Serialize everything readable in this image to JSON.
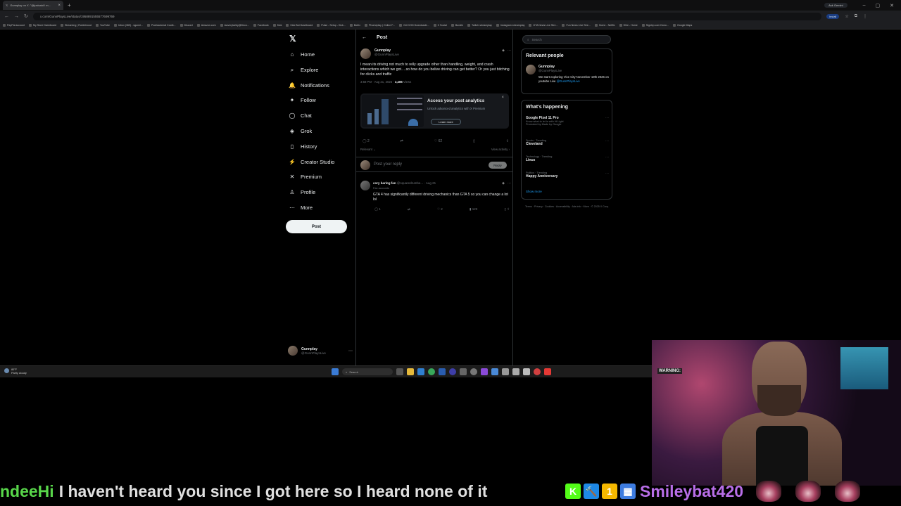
{
  "browser": {
    "tab_title": "Gunnplay on X: \"@justsaid I m…",
    "gemini_label": "Ask Gemini",
    "url": "x.com/GunnPlaysLive/status/1958891555577699769",
    "install_label": "Install",
    "bookmarks": [
      "PayPal account",
      "My Store Dashboard",
      "Streaming | Rubinbrood",
      "YouTube",
      "Inbox (369) - sgunnl...",
      "Pool/automat Coolb...",
      "Discord",
      "Amazon.com",
      "taoverylarkly@Deco...",
      "Facebook",
      "Kick",
      "Kick Bot Dashboard",
      "Pulse - Setup - Kick...",
      "Botrix",
      "Phomeplay | Online F...",
      "Grit VOD Downloade...",
      "X Social",
      "Bundle",
      "Twitch streamplay",
      "Instagram streamplay",
      "GTA News Live Stre...",
      "Fun News Live Stre...",
      "Home - Netflix",
      "Wire - Home",
      "SignUp.com Dono...",
      "Google Maps"
    ]
  },
  "nav": {
    "items": [
      {
        "label": "Home",
        "icon": "home-icon",
        "glyph": "⌂"
      },
      {
        "label": "Explore",
        "icon": "search-icon",
        "glyph": "⌕"
      },
      {
        "label": "Notifications",
        "icon": "bell-icon",
        "glyph": "🔔"
      },
      {
        "label": "Follow",
        "icon": "follow-icon",
        "glyph": "✦"
      },
      {
        "label": "Chat",
        "icon": "chat-icon",
        "glyph": "◯"
      },
      {
        "label": "Grok",
        "icon": "grok-icon",
        "glyph": "◈"
      },
      {
        "label": "History",
        "icon": "bookmark-icon",
        "glyph": "▯"
      },
      {
        "label": "Creator Studio",
        "icon": "creator-studio-icon",
        "glyph": "⚡"
      },
      {
        "label": "Premium",
        "icon": "premium-icon",
        "glyph": "✕"
      },
      {
        "label": "Profile",
        "icon": "profile-icon",
        "glyph": "♙"
      },
      {
        "label": "More",
        "icon": "more-icon",
        "glyph": "⋯"
      }
    ],
    "post_button": "Post",
    "account_name": "Gunnplay",
    "account_handle": "@GunnPlaysLive"
  },
  "main": {
    "header_title": "Post",
    "tweet": {
      "name": "Gunnplay",
      "handle": "@GunnPlaysLive",
      "text": "I mean its driving not much to relly upgrade other than handling, weight, and crash interactions which we got….so how do you belive driving can get better? Or you just bitching for clicks and traffic",
      "timestamp": "3:58 PM · Aug 21, 2025 · ",
      "views": "2,486",
      "views_label": " Views"
    },
    "analytics": {
      "title": "Access your post analytics",
      "subtitle": "Unlock advanced analytics with X Premium",
      "button": "Learn more"
    },
    "actions": {
      "replies": "2",
      "likes": "62"
    },
    "relevant_label": "Relevant ⌄",
    "view_activity": "View activity ›",
    "reply_placeholder": "Post your reply",
    "reply_button": "Reply",
    "reply": {
      "name": "cory barlog fan",
      "handle": "@squaredrumbe... · Aug 21",
      "fan_label": "Fan accounts",
      "text": "GTA 4 has significantly different driving mechanics than GTA 5 so you can change a lot lol",
      "replies": "1",
      "likes": "2",
      "views": "123"
    }
  },
  "right": {
    "search_placeholder": "Search",
    "relevant_title": "Relevant people",
    "person": {
      "name": "Gunnplay",
      "handle": "@GunnPlaysLive",
      "bio": "We start exploring Vice City November 19th 2026 on youtube Live ",
      "bio_link": "@GunnPlaysLive"
    },
    "happening_title": "What's happening",
    "trends": [
      {
        "category": "",
        "title": "Google Pixel 11 Pro",
        "sub": "Know what to let in with Hi Light"
      },
      {
        "category": "Sports · Trending",
        "title": "Cleveland",
        "sub": ""
      },
      {
        "category": "Technology · Trending",
        "title": "Linux",
        "sub": ""
      },
      {
        "category": "Politics · Trending",
        "title": "Happy Anniversary",
        "sub": ""
      }
    ],
    "promoted": "Promoted by Made by Google",
    "show_more": "Show more",
    "footer": "Terms · Privacy · Cookies · Accessibility · Ads info · More · © 2025 X Corp."
  },
  "taskbar": {
    "weather_temp": "80°F",
    "weather_desc": "Partly cloudy",
    "search_placeholder": "Search"
  },
  "webcam": {
    "warning": "WARNING:"
  },
  "chat": {
    "user": "ndeeHi",
    "message": "I haven't heard you since I got here so I heard none of it",
    "user2": "Smileybat420",
    "badges": [
      {
        "glyph": "K",
        "color": "#53fc18"
      },
      {
        "glyph": "🔨",
        "color": "#1e88e5"
      },
      {
        "glyph": "1",
        "color": "#f5b800"
      },
      {
        "glyph": "▦",
        "color": "#3d7ce0"
      }
    ]
  }
}
